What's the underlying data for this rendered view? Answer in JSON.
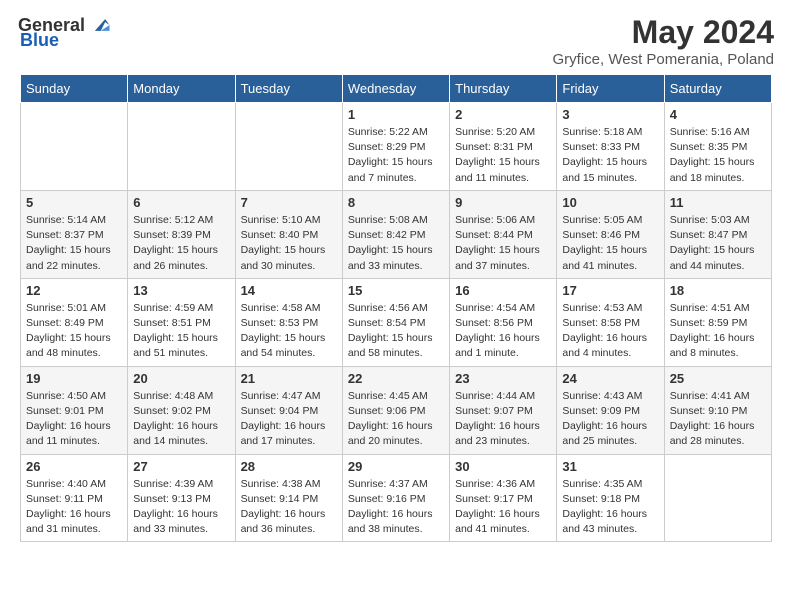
{
  "header": {
    "logo_general": "General",
    "logo_blue": "Blue",
    "title": "May 2024",
    "subtitle": "Gryfice, West Pomerania, Poland"
  },
  "days_of_week": [
    "Sunday",
    "Monday",
    "Tuesday",
    "Wednesday",
    "Thursday",
    "Friday",
    "Saturday"
  ],
  "weeks": [
    [
      {
        "day": "",
        "info": ""
      },
      {
        "day": "",
        "info": ""
      },
      {
        "day": "",
        "info": ""
      },
      {
        "day": "1",
        "info": "Sunrise: 5:22 AM\nSunset: 8:29 PM\nDaylight: 15 hours\nand 7 minutes."
      },
      {
        "day": "2",
        "info": "Sunrise: 5:20 AM\nSunset: 8:31 PM\nDaylight: 15 hours\nand 11 minutes."
      },
      {
        "day": "3",
        "info": "Sunrise: 5:18 AM\nSunset: 8:33 PM\nDaylight: 15 hours\nand 15 minutes."
      },
      {
        "day": "4",
        "info": "Sunrise: 5:16 AM\nSunset: 8:35 PM\nDaylight: 15 hours\nand 18 minutes."
      }
    ],
    [
      {
        "day": "5",
        "info": "Sunrise: 5:14 AM\nSunset: 8:37 PM\nDaylight: 15 hours\nand 22 minutes."
      },
      {
        "day": "6",
        "info": "Sunrise: 5:12 AM\nSunset: 8:39 PM\nDaylight: 15 hours\nand 26 minutes."
      },
      {
        "day": "7",
        "info": "Sunrise: 5:10 AM\nSunset: 8:40 PM\nDaylight: 15 hours\nand 30 minutes."
      },
      {
        "day": "8",
        "info": "Sunrise: 5:08 AM\nSunset: 8:42 PM\nDaylight: 15 hours\nand 33 minutes."
      },
      {
        "day": "9",
        "info": "Sunrise: 5:06 AM\nSunset: 8:44 PM\nDaylight: 15 hours\nand 37 minutes."
      },
      {
        "day": "10",
        "info": "Sunrise: 5:05 AM\nSunset: 8:46 PM\nDaylight: 15 hours\nand 41 minutes."
      },
      {
        "day": "11",
        "info": "Sunrise: 5:03 AM\nSunset: 8:47 PM\nDaylight: 15 hours\nand 44 minutes."
      }
    ],
    [
      {
        "day": "12",
        "info": "Sunrise: 5:01 AM\nSunset: 8:49 PM\nDaylight: 15 hours\nand 48 minutes."
      },
      {
        "day": "13",
        "info": "Sunrise: 4:59 AM\nSunset: 8:51 PM\nDaylight: 15 hours\nand 51 minutes."
      },
      {
        "day": "14",
        "info": "Sunrise: 4:58 AM\nSunset: 8:53 PM\nDaylight: 15 hours\nand 54 minutes."
      },
      {
        "day": "15",
        "info": "Sunrise: 4:56 AM\nSunset: 8:54 PM\nDaylight: 15 hours\nand 58 minutes."
      },
      {
        "day": "16",
        "info": "Sunrise: 4:54 AM\nSunset: 8:56 PM\nDaylight: 16 hours\nand 1 minute."
      },
      {
        "day": "17",
        "info": "Sunrise: 4:53 AM\nSunset: 8:58 PM\nDaylight: 16 hours\nand 4 minutes."
      },
      {
        "day": "18",
        "info": "Sunrise: 4:51 AM\nSunset: 8:59 PM\nDaylight: 16 hours\nand 8 minutes."
      }
    ],
    [
      {
        "day": "19",
        "info": "Sunrise: 4:50 AM\nSunset: 9:01 PM\nDaylight: 16 hours\nand 11 minutes."
      },
      {
        "day": "20",
        "info": "Sunrise: 4:48 AM\nSunset: 9:02 PM\nDaylight: 16 hours\nand 14 minutes."
      },
      {
        "day": "21",
        "info": "Sunrise: 4:47 AM\nSunset: 9:04 PM\nDaylight: 16 hours\nand 17 minutes."
      },
      {
        "day": "22",
        "info": "Sunrise: 4:45 AM\nSunset: 9:06 PM\nDaylight: 16 hours\nand 20 minutes."
      },
      {
        "day": "23",
        "info": "Sunrise: 4:44 AM\nSunset: 9:07 PM\nDaylight: 16 hours\nand 23 minutes."
      },
      {
        "day": "24",
        "info": "Sunrise: 4:43 AM\nSunset: 9:09 PM\nDaylight: 16 hours\nand 25 minutes."
      },
      {
        "day": "25",
        "info": "Sunrise: 4:41 AM\nSunset: 9:10 PM\nDaylight: 16 hours\nand 28 minutes."
      }
    ],
    [
      {
        "day": "26",
        "info": "Sunrise: 4:40 AM\nSunset: 9:11 PM\nDaylight: 16 hours\nand 31 minutes."
      },
      {
        "day": "27",
        "info": "Sunrise: 4:39 AM\nSunset: 9:13 PM\nDaylight: 16 hours\nand 33 minutes."
      },
      {
        "day": "28",
        "info": "Sunrise: 4:38 AM\nSunset: 9:14 PM\nDaylight: 16 hours\nand 36 minutes."
      },
      {
        "day": "29",
        "info": "Sunrise: 4:37 AM\nSunset: 9:16 PM\nDaylight: 16 hours\nand 38 minutes."
      },
      {
        "day": "30",
        "info": "Sunrise: 4:36 AM\nSunset: 9:17 PM\nDaylight: 16 hours\nand 41 minutes."
      },
      {
        "day": "31",
        "info": "Sunrise: 4:35 AM\nSunset: 9:18 PM\nDaylight: 16 hours\nand 43 minutes."
      },
      {
        "day": "",
        "info": ""
      }
    ]
  ]
}
